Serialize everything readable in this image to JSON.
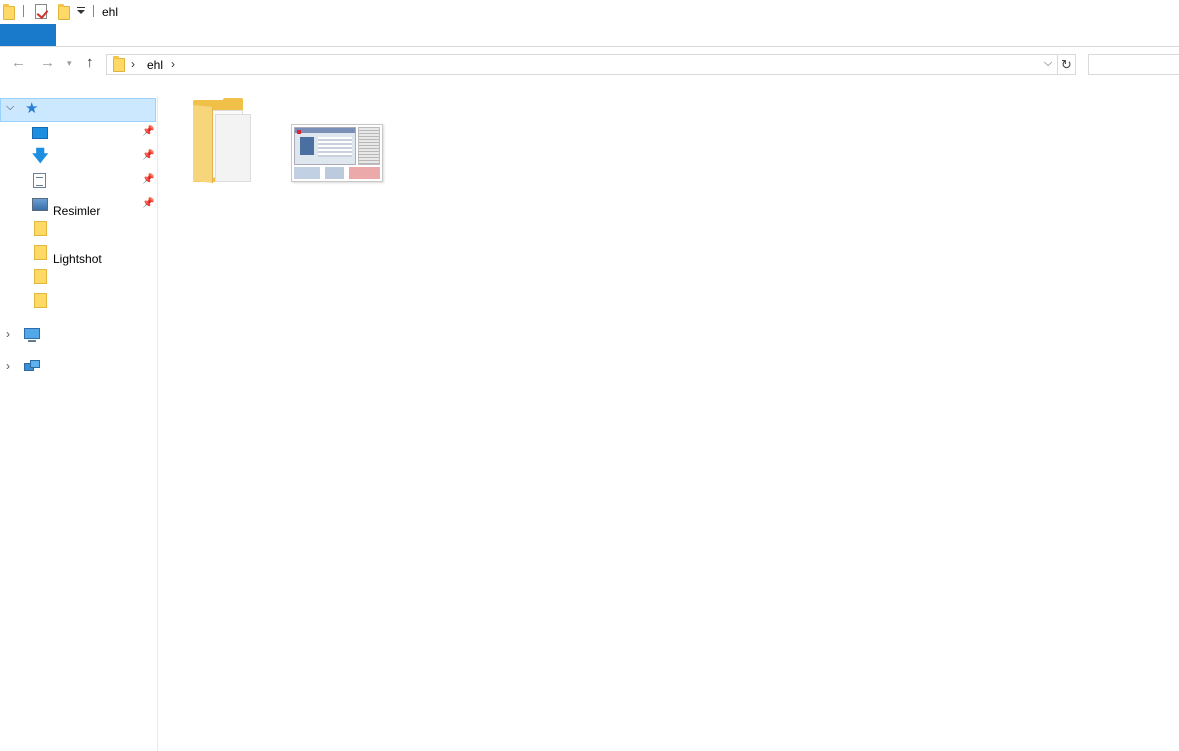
{
  "window": {
    "title": "ehl"
  },
  "address_bar": {
    "path": [
      "ehl"
    ]
  },
  "nav_pane": {
    "items": [
      {
        "label": "",
        "icon": "desktop-icon",
        "pinned": true
      },
      {
        "label": "",
        "icon": "download-icon",
        "pinned": true
      },
      {
        "label": "",
        "icon": "documents-icon",
        "pinned": true
      },
      {
        "label": "Resimler",
        "icon": "pictures-icon",
        "pinned": true
      },
      {
        "label": "",
        "icon": "folder-icon",
        "pinned": false
      },
      {
        "label": "Lightshot",
        "icon": "folder-icon",
        "pinned": false
      },
      {
        "label": "",
        "icon": "folder-icon",
        "pinned": false
      },
      {
        "label": "",
        "icon": "folder-icon",
        "pinned": false
      }
    ]
  },
  "content": {
    "items": [
      {
        "type": "folder",
        "icon": "folder-icon"
      },
      {
        "type": "image",
        "icon": "image-thumbnail"
      }
    ]
  },
  "colors": {
    "accent": "#1979ca",
    "selection": "#cce8ff",
    "folder": "#ffd966"
  }
}
